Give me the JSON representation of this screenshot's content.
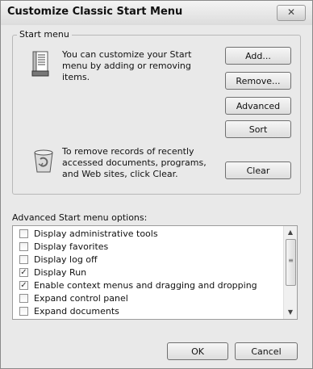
{
  "window": {
    "title": "Customize Classic Start Menu",
    "close_label": "✕"
  },
  "start_menu": {
    "legend": "Start menu",
    "customize_text": "You can customize your Start menu by adding or removing items.",
    "clear_text": "To remove records of recently accessed documents, programs, and Web sites, click Clear.",
    "buttons": {
      "add": "Add...",
      "remove": "Remove...",
      "advanced": "Advanced",
      "sort": "Sort",
      "clear": "Clear"
    }
  },
  "advanced": {
    "label": "Advanced Start menu options:",
    "items": [
      {
        "label": "Display administrative tools",
        "checked": false
      },
      {
        "label": "Display favorites",
        "checked": false
      },
      {
        "label": "Display log off",
        "checked": false
      },
      {
        "label": "Display Run",
        "checked": true
      },
      {
        "label": "Enable context menus and dragging and dropping",
        "checked": true
      },
      {
        "label": "Expand control panel",
        "checked": false
      },
      {
        "label": "Expand documents",
        "checked": false
      }
    ]
  },
  "footer": {
    "ok": "OK",
    "cancel": "Cancel"
  }
}
